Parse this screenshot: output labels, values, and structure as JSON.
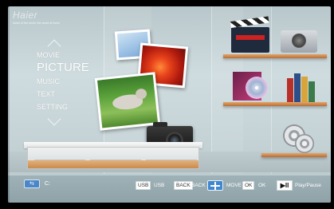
{
  "brand": {
    "logo_text": "Haier",
    "tagline": "home of the world, the world of home"
  },
  "menu": {
    "items": [
      {
        "label": "MOVIE",
        "selected": false
      },
      {
        "label": "PICTURE",
        "selected": true
      },
      {
        "label": "MUSIC",
        "selected": false
      },
      {
        "label": "TEXT",
        "selected": false
      },
      {
        "label": "SETTING",
        "selected": false
      }
    ],
    "scroll_up_icon": "chevron-up-icon",
    "scroll_down_icon": "chevron-down-icon"
  },
  "footer": {
    "drive_icon": "usb-drive-icon",
    "drive_label": "C:",
    "hints": [
      {
        "key": "USB",
        "label": "USB"
      },
      {
        "key": "BACK",
        "label": "BACK"
      },
      {
        "key_icon": "move-arrows-icon",
        "label": "MOVE"
      },
      {
        "key": "OK",
        "label": "OK"
      },
      {
        "key_glyph": "▶II",
        "label": "Play/Pause"
      }
    ]
  },
  "colors": {
    "background": "#c4d2d6",
    "shelf_wood": "#c98a4e",
    "key_blue": "#3f87d0",
    "text": "#ffffff"
  }
}
